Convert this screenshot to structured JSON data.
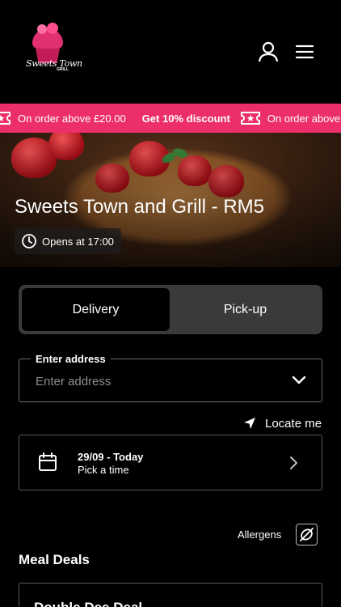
{
  "header": {
    "logo_text": "Sweets Town",
    "logo_subtext": "GRILL",
    "user_icon": "user-icon",
    "menu_icon": "hamburger-menu-icon"
  },
  "promo_banner": {
    "icon": "ticket-star-icon",
    "items": [
      {
        "text": "On order above £20.00",
        "bold": "Get 10% discount"
      },
      {
        "text": "On order above"
      }
    ]
  },
  "hero": {
    "title": "Sweets Town and Grill - RM5",
    "hours_icon": "clock-icon",
    "hours": "Opens at 17:00"
  },
  "order_mode": {
    "options": [
      "Delivery",
      "Pick-up"
    ],
    "selected": "Delivery"
  },
  "address": {
    "label": "Enter address",
    "placeholder": "Enter address",
    "value": "",
    "dropdown_icon": "chevron-down-icon"
  },
  "locate": {
    "icon": "location-arrow-icon",
    "label": "Locate me"
  },
  "schedule": {
    "icon": "calendar-icon",
    "date": "29/09 - Today",
    "time": "Pick a time",
    "chevron_icon": "chevron-right-icon"
  },
  "allergens": {
    "label": "Allergens",
    "icon": "allergen-filter-icon"
  },
  "menu": {
    "section_title": "Meal Deals",
    "items": [
      {
        "title": "Double Dee Deal"
      }
    ]
  },
  "colors": {
    "accent": "#ec2f6a",
    "background": "#000000",
    "segment_bg": "#3a3a3c",
    "border": "#6e6e6e"
  }
}
